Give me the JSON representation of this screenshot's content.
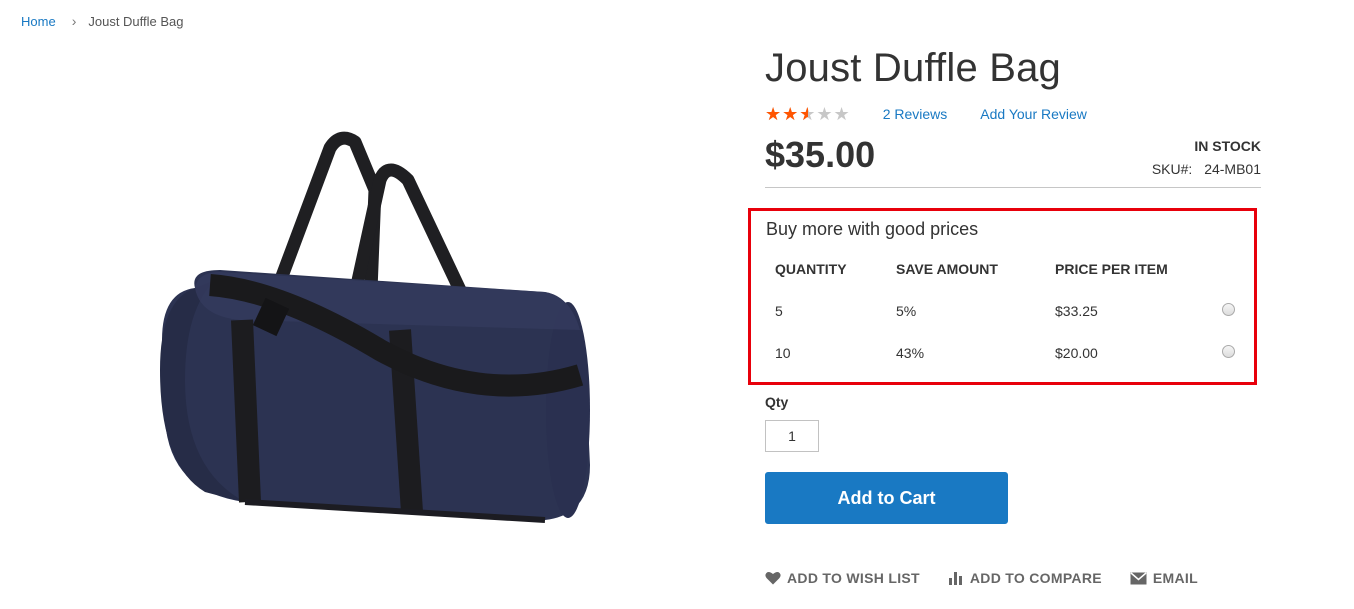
{
  "breadcrumb": {
    "home": "Home",
    "separator": "›",
    "current": "Joust Duffle Bag"
  },
  "product": {
    "title": "Joust Duffle Bag",
    "rating": {
      "stars_filled": 2.5,
      "stars_total": 5,
      "percent": 50
    },
    "reviews_link": "2  Reviews",
    "add_review": "Add Your Review",
    "price": "$35.00",
    "stock": "IN STOCK",
    "sku_label": "SKU#:",
    "sku_value": "24-MB01",
    "image_icon": "duffle-bag-photo"
  },
  "tier_prices": {
    "title": "Buy more with good prices",
    "headers": [
      "QUANTITY",
      "SAVE AMOUNT",
      "PRICE PER ITEM"
    ],
    "rows": [
      {
        "quantity": "5",
        "save": "5%",
        "price": "$33.25"
      },
      {
        "quantity": "10",
        "save": "43%",
        "price": "$20.00"
      }
    ],
    "highlight_color": "#e8000b"
  },
  "qty": {
    "label": "Qty",
    "value": "1"
  },
  "add_to_cart": "Add to Cart",
  "actions": {
    "wishlist": "ADD TO WISH LIST",
    "compare": "ADD TO COMPARE",
    "email": "EMAIL"
  },
  "colors": {
    "link": "#1979c3",
    "star": "#ff5501",
    "button": "#1979c3"
  }
}
